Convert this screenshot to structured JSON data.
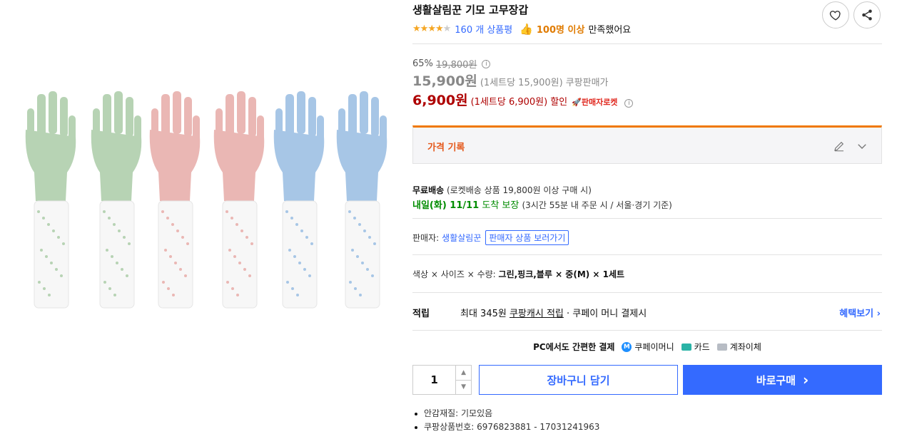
{
  "product": {
    "title": "생활살림꾼 기모 고무장갑",
    "rating": 4,
    "rating_max": 5,
    "review_count_text": "160 개 상품평",
    "satisfied_count": "100명 이상",
    "satisfied_text": "만족했어요",
    "image_glove_colors": [
      "#b7d3b4",
      "#b7d3b4",
      "#eab7b4",
      "#eab7b4",
      "#a7c6e6",
      "#a7c6e6"
    ]
  },
  "price": {
    "discount_rate": "65%",
    "original_price": "19,800원",
    "coupang_price": "15,900원",
    "coupang_unit": "(1세트당 15,900원)",
    "coupang_label": "쿠팡판매가",
    "seller_price": "6,900원",
    "seller_unit": "(1세트당 6,900원)",
    "seller_label": "할인",
    "rocket_label": "판매자로켓"
  },
  "price_history": {
    "label": "가격 기록"
  },
  "shipping": {
    "free_label": "무료배송",
    "free_detail": "(로켓배송 상품 19,800원 이상 구매 시)",
    "arrival_date": "내일(화) 11/11",
    "arrival_label": "도착 보장",
    "arrival_detail": "(3시간 55분 내 주문 시 / 서울·경기 기준)"
  },
  "seller": {
    "label": "판매자:",
    "name": "생활살림꾼",
    "link": "판매자 상품 보러가기"
  },
  "option": {
    "label": "색상 × 사이즈 × 수량:",
    "value": "그린,핑크,블루 × 중(M) × 1세트"
  },
  "reward": {
    "label": "적립",
    "prefix": "최대 345원",
    "cash_link": "쿠팡캐시 적립",
    "suffix": "· 쿠페이 머니 결제시",
    "benefit_link": "혜택보기 ›"
  },
  "payment": {
    "title": "PC에서도 간편한 결제",
    "m_badge": "M",
    "method1": "쿠페이머니",
    "method2": "카드",
    "method3": "계좌이체"
  },
  "purchase": {
    "quantity": "1",
    "qty_up": "▲",
    "qty_down": "▼",
    "cart_label": "장바구니 담기",
    "buy_label": "바로구매",
    "buy_arrow": "›"
  },
  "details": [
    "안감재질: 기모있음",
    "쿠팡상품번호: 6976823881 - 17031241963"
  ],
  "colors": {
    "accent": "#346aff",
    "sale": "#ae0000",
    "arrival": "#008c00",
    "history_bar": "#f07800"
  }
}
